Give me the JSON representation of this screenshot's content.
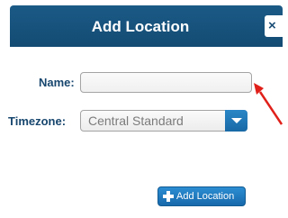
{
  "dialog": {
    "title": "Add Location",
    "close_label": "×"
  },
  "form": {
    "name_label": "Name:",
    "name_value": "",
    "timezone_label": "Timezone:",
    "timezone_selected": "Central Standard"
  },
  "actions": {
    "add_label": "Add Location"
  },
  "annotation": {
    "arrow_color": "#e0201a"
  },
  "colors": {
    "titlebar": "#1b5a86",
    "label_text": "#17466e",
    "button": "#1f78bf"
  },
  "icons": {
    "close": "close-icon",
    "dropdown": "chevron-down-icon",
    "add": "plus-icon"
  }
}
